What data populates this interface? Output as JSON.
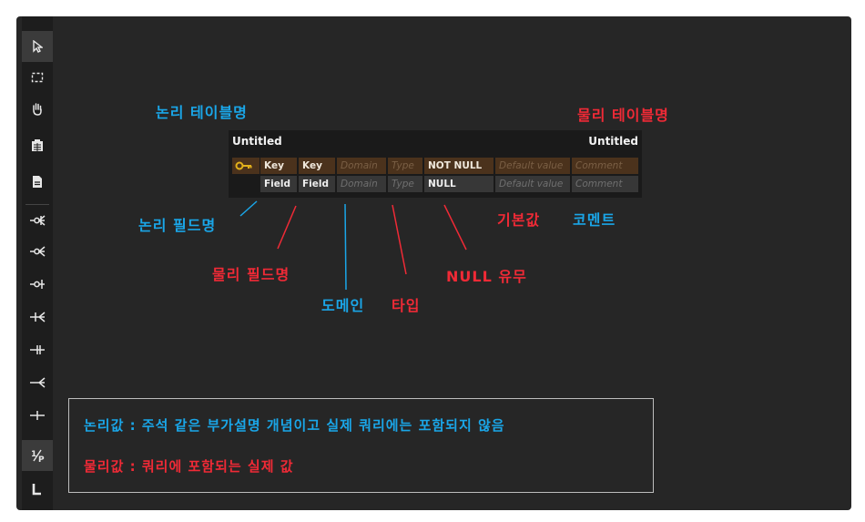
{
  "toolbar": {
    "tools": [
      "pointer-icon",
      "select-area-icon",
      "hand-icon",
      "table-icon",
      "note-icon",
      "relation-zero-many-icon",
      "relation-zero-many-alt-icon",
      "relation-zero-one-icon",
      "relation-one-many-icon",
      "relation-one-one-icon",
      "relation-many-icon",
      "relation-line-icon",
      "fraction-icon",
      "l-shape-icon"
    ]
  },
  "labels": {
    "logical_table_name": "논리 테이블명",
    "physical_table_name": "물리 테이블명",
    "logical_field_name": "논리 필드명",
    "physical_field_name": "물리 필드명",
    "domain": "도메인",
    "type": "타입",
    "null_flag": "NULL 유무",
    "default_value": "기본값",
    "comment": "코멘트"
  },
  "entity": {
    "logical_title": "Untitled",
    "physical_title": "Untitled",
    "rows": [
      {
        "logical": "Key",
        "physical": "Key",
        "domain": "Domain",
        "type": "Type",
        "null": "NOT NULL",
        "default": "Default value",
        "comment": "Comment"
      },
      {
        "logical": "Field",
        "physical": "Field",
        "domain": "Domain",
        "type": "Type",
        "null": "NULL",
        "default": "Default value",
        "comment": "Comment"
      }
    ]
  },
  "notes": {
    "logical_value": "논리값 : 주석 같은 부가설명 개념이고 실제 쿼리에는 포함되지 않음",
    "physical_value": "물리값 : 쿼리에 포함되는 실제 값"
  },
  "colors": {
    "blue": "#1aa6e8",
    "red": "#f02a36",
    "key_row": "#4b321c",
    "field_row": "#373737"
  }
}
